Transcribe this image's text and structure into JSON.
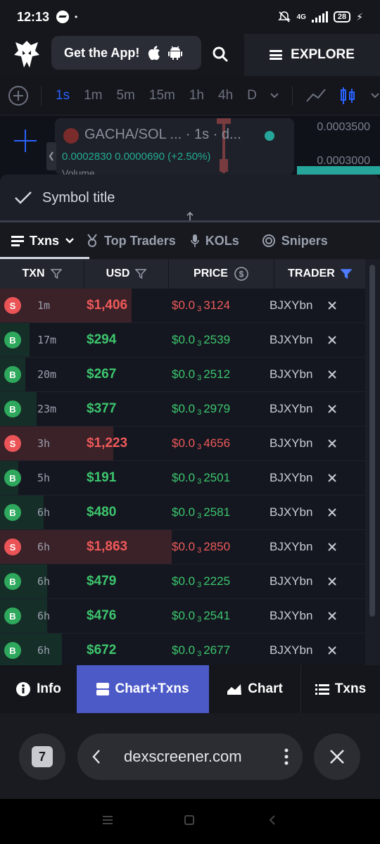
{
  "status_bar": {
    "time": "12:13",
    "dot": "•",
    "network": "4G",
    "battery": "28"
  },
  "header": {
    "get_app_label": "Get the App!",
    "explore_label": "EXPLORE"
  },
  "chart_toolbar": {
    "timeframes": [
      "1s",
      "1m",
      "5m",
      "15m",
      "1h",
      "4h",
      "D"
    ],
    "active_timeframe": "1s"
  },
  "chart": {
    "symbol_line": "GACHA/SOL ... · 1s · d...",
    "price_change": "0.0002830  0.0000690 (+2.50%)",
    "axis_top": "0.0003500",
    "axis_mid": "0.0003000",
    "volume_label": "Volume"
  },
  "sheet": {
    "title": "Symbol title"
  },
  "tabs": [
    {
      "label": "Txns",
      "icon": "list-icon"
    },
    {
      "label": "Top Traders",
      "icon": "medal-icon"
    },
    {
      "label": "KOLs",
      "icon": "microphone-icon"
    },
    {
      "label": "Snipers",
      "icon": "target-icon"
    }
  ],
  "table": {
    "headers": {
      "txn": "TXN",
      "usd": "USD",
      "price": "PRICE",
      "trader": "TRADER"
    },
    "rows": [
      {
        "type": "S",
        "age": "1m",
        "usd": "$1,406",
        "price_prefix": "$0.0",
        "zeros": "3",
        "price_digits": "3124",
        "trader": "BJXYbn",
        "bar": 0.36
      },
      {
        "type": "B",
        "age": "17m",
        "usd": "$294",
        "price_prefix": "$0.0",
        "zeros": "3",
        "price_digits": "2539",
        "trader": "BJXYbn",
        "bar": 0.08
      },
      {
        "type": "B",
        "age": "20m",
        "usd": "$267",
        "price_prefix": "$0.0",
        "zeros": "3",
        "price_digits": "2512",
        "trader": "BJXYbn",
        "bar": 0.07
      },
      {
        "type": "B",
        "age": "23m",
        "usd": "$377",
        "price_prefix": "$0.0",
        "zeros": "3",
        "price_digits": "2979",
        "trader": "BJXYbn",
        "bar": 0.1
      },
      {
        "type": "S",
        "age": "3h",
        "usd": "$1,223",
        "price_prefix": "$0.0",
        "zeros": "3",
        "price_digits": "4656",
        "trader": "BJXYbn",
        "bar": 0.31
      },
      {
        "type": "B",
        "age": "5h",
        "usd": "$191",
        "price_prefix": "$0.0",
        "zeros": "3",
        "price_digits": "2501",
        "trader": "BJXYbn",
        "bar": 0.05
      },
      {
        "type": "B",
        "age": "6h",
        "usd": "$480",
        "price_prefix": "$0.0",
        "zeros": "3",
        "price_digits": "2581",
        "trader": "BJXYbn",
        "bar": 0.12
      },
      {
        "type": "S",
        "age": "6h",
        "usd": "$1,863",
        "price_prefix": "$0.0",
        "zeros": "3",
        "price_digits": "2850",
        "trader": "BJXYbn",
        "bar": 0.47
      },
      {
        "type": "B",
        "age": "6h",
        "usd": "$479",
        "price_prefix": "$0.0",
        "zeros": "3",
        "price_digits": "2225",
        "trader": "BJXYbn",
        "bar": 0.13
      },
      {
        "type": "B",
        "age": "6h",
        "usd": "$476",
        "price_prefix": "$0.0",
        "zeros": "3",
        "price_digits": "2541",
        "trader": "BJXYbn",
        "bar": 0.13
      },
      {
        "type": "B",
        "age": "6h",
        "usd": "$672",
        "price_prefix": "$0.0",
        "zeros": "3",
        "price_digits": "2677",
        "trader": "BJXYbn",
        "bar": 0.17
      }
    ]
  },
  "bottom_nav": [
    {
      "label": "Info",
      "icon": "info-icon"
    },
    {
      "label": "Chart+Txns",
      "icon": "split-view-icon",
      "active": true
    },
    {
      "label": "Chart",
      "icon": "area-chart-icon"
    },
    {
      "label": "Txns",
      "icon": "list-icon"
    }
  ],
  "browser": {
    "tab_count": "7",
    "url": "dexscreener.com"
  },
  "colors": {
    "accent": "#4c5ac8",
    "buy": "#3dc66d",
    "sell": "#ef5a5a",
    "background": "#141720"
  }
}
